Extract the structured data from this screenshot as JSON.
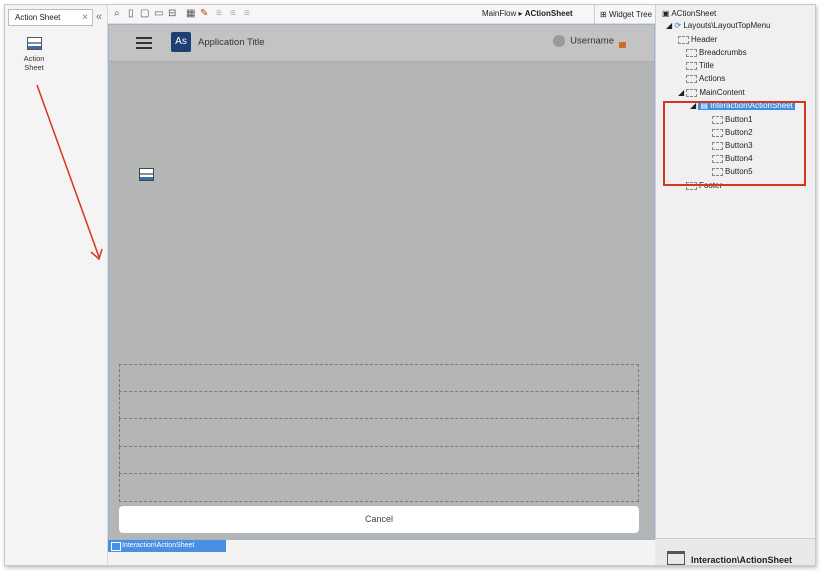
{
  "toolbox": {
    "search_value": "Action Sheet",
    "clear": "×",
    "collapse": "«",
    "tool_label": "Action Sheet"
  },
  "toolbar": {
    "breadcrumb_flow": "MainFlow ▸ ",
    "breadcrumb_screen": "ACtionSheet",
    "widget_tree": "Widget Tree"
  },
  "canvas": {
    "logo_text": "As",
    "app_title": "Application Title",
    "username": "Username",
    "cancel_label": "Cancel",
    "selection_label": "Interaction\\ActionSheet"
  },
  "tree": {
    "root": "ACtionSheet",
    "layout": "Layouts\\LayoutTopMenu",
    "header": "Header",
    "breadcrumbs": "Breadcrumbs",
    "title": "Title",
    "actions": "Actions",
    "main_content": "MainContent",
    "action_sheet": "Interaction\\ActionSheet",
    "buttons": [
      "Button1",
      "Button2",
      "Button3",
      "Button4",
      "Button5"
    ],
    "footer": "Footer"
  },
  "bottom_panel": {
    "label": "Interaction\\ActionSheet"
  },
  "colors": {
    "annotation": "#d6361e",
    "selection": "#3d8ee0",
    "logo": "#1e3f73"
  }
}
